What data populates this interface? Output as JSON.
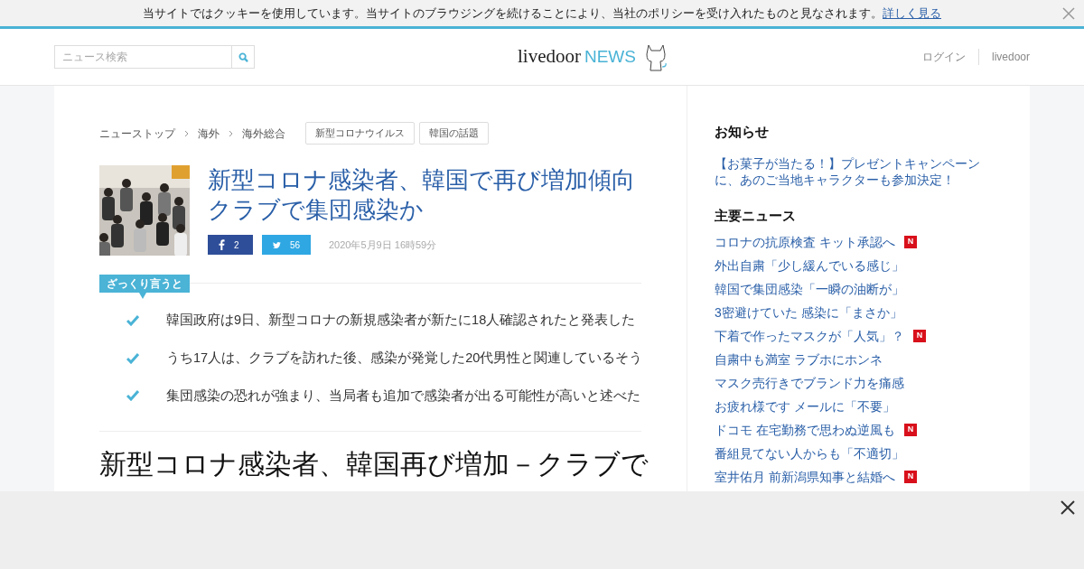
{
  "cookie_bar": {
    "message": "当サイトではクッキーを使用しています。当サイトのブラウジングを続けることにより、当社のポリシーを受け入れたものと見なされます。",
    "link": "詳しく見る"
  },
  "header": {
    "search": {
      "placeholder": "ニュース検索"
    },
    "logo": {
      "brand": "livedoor",
      "suffix": "NEWS"
    },
    "links": [
      "ログイン",
      "livedoor"
    ]
  },
  "breadcrumbs": [
    "ニューストップ",
    "海外",
    "海外総合"
  ],
  "tags": [
    "新型コロナウイルス",
    "韓国の話題"
  ],
  "article": {
    "title": "新型コロナ感染者、韓国で再び増加傾向クラブで集団感染か",
    "share": [
      {
        "kind": "facebook",
        "count": "2"
      },
      {
        "kind": "twitter",
        "count": "56"
      }
    ],
    "date": "2020年5月9日 16時59分"
  },
  "summary": {
    "label": "ざっくり言うと",
    "points": [
      "韓国政府は9日、新型コロナの新規感染者が新たに18人確認されたと発表した",
      "うち17人は、クラブを訪れた後、感染が発覚した20代男性と関連しているそう",
      "集団感染の恐れが強まり、当局者も追加で感染者が出る可能性が高いと述べた"
    ]
  },
  "body_heading": "新型コロナ感染者、韓国再び増加－クラブで",
  "sidebar": {
    "notice": {
      "title": "お知らせ",
      "link": "【お菓子が当たる！】プレゼントキャンペーンに、あのご当地キャラクターも参加決定！"
    },
    "main_news": {
      "title": "主要ニュース",
      "items": [
        {
          "text": "コロナの抗原検査 キット承認へ",
          "new_badge": "N"
        },
        {
          "text": "外出自粛「少し緩んでいる感じ」"
        },
        {
          "text": "韓国で集団感染「一瞬の油断が」"
        },
        {
          "text": "3密避けていた 感染に「まさか」"
        },
        {
          "text": "下着で作ったマスクが「人気」？",
          "new_badge": "N"
        },
        {
          "text": "自粛中も満室 ラブホにホンネ"
        },
        {
          "text": "マスク売行きでブランド力を痛感"
        },
        {
          "text": "お疲れ様です メールに「不要」"
        },
        {
          "text": "ドコモ 在宅勤務で思わぬ逆風も",
          "new_badge": "N"
        },
        {
          "text": "番組見てない人からも「不適切」"
        },
        {
          "text": "室井佑月 前新潟県知事と結婚へ",
          "new_badge": "N"
        }
      ]
    }
  }
}
